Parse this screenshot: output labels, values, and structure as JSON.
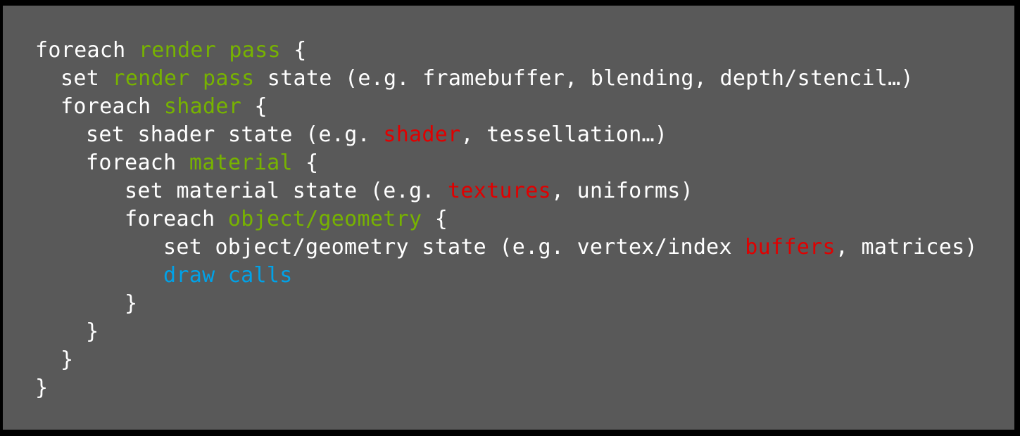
{
  "colors": {
    "background": "#595959",
    "frame": "#000000",
    "text": "#FFFFFF",
    "loop_variable": "#77B300",
    "state_highlight": "#E00000",
    "draw_highlight": "#00A2E8"
  },
  "code": {
    "lines": [
      {
        "indent": 0,
        "tokens": [
          {
            "text": "foreach ",
            "kind": "plain"
          },
          {
            "text": "render pass",
            "kind": "loop_variable"
          },
          {
            "text": " {",
            "kind": "plain"
          }
        ]
      },
      {
        "indent": 1,
        "tokens": [
          {
            "text": "set ",
            "kind": "plain"
          },
          {
            "text": "render pass",
            "kind": "loop_variable"
          },
          {
            "text": " state (e.g. framebuffer, blending, depth/stencil…)",
            "kind": "plain"
          }
        ]
      },
      {
        "indent": 1,
        "tokens": [
          {
            "text": "foreach ",
            "kind": "plain"
          },
          {
            "text": "shader",
            "kind": "loop_variable"
          },
          {
            "text": " {",
            "kind": "plain"
          }
        ]
      },
      {
        "indent": 2,
        "tokens": [
          {
            "text": "set shader state (e.g. ",
            "kind": "plain"
          },
          {
            "text": "shader",
            "kind": "state_highlight"
          },
          {
            "text": ", tessellation…)",
            "kind": "plain"
          }
        ]
      },
      {
        "indent": 2,
        "tokens": [
          {
            "text": "foreach ",
            "kind": "plain"
          },
          {
            "text": "material",
            "kind": "loop_variable"
          },
          {
            "text": " {",
            "kind": "plain"
          }
        ]
      },
      {
        "indent": 3,
        "tokens": [
          {
            "text": "set material state (e.g. ",
            "kind": "plain"
          },
          {
            "text": "textures",
            "kind": "state_highlight"
          },
          {
            "text": ", uniforms)",
            "kind": "plain"
          }
        ]
      },
      {
        "indent": 3,
        "tokens": [
          {
            "text": "foreach ",
            "kind": "plain"
          },
          {
            "text": "object/geometry",
            "kind": "loop_variable"
          },
          {
            "text": " {",
            "kind": "plain"
          }
        ]
      },
      {
        "indent": 4,
        "tokens": [
          {
            "text": "set object/geometry state (e.g. vertex/index ",
            "kind": "plain"
          },
          {
            "text": "buffers",
            "kind": "state_highlight"
          },
          {
            "text": ", matrices)",
            "kind": "plain"
          }
        ]
      },
      {
        "indent": 4,
        "tokens": [
          {
            "text": "draw calls",
            "kind": "draw_highlight"
          }
        ]
      },
      {
        "indent": 3,
        "tokens": [
          {
            "text": "}",
            "kind": "plain"
          }
        ]
      },
      {
        "indent": 2,
        "tokens": [
          {
            "text": "}",
            "kind": "plain"
          }
        ]
      },
      {
        "indent": 1,
        "tokens": [
          {
            "text": "}",
            "kind": "plain"
          }
        ]
      },
      {
        "indent": 0,
        "tokens": [
          {
            "text": "}",
            "kind": "plain"
          }
        ]
      }
    ]
  }
}
